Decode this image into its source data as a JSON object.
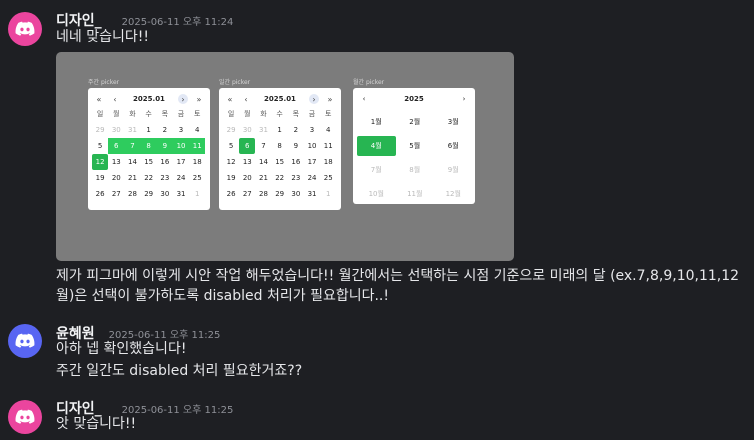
{
  "colors": {
    "background": "#1e1f23",
    "avatar_pink": "#eb459e",
    "avatar_blue": "#5865f2",
    "selected_green": "#2ecc5e"
  },
  "messages": [
    {
      "author": "디자인_",
      "timestamp": "2025-06-11 오후 11:24",
      "avatar_icon": "discord-icon",
      "lines": [
        "네네 맞습니다!!"
      ]
    },
    {
      "caption": "제가 피그마에 이렇게 시안 작업 해두었습니다!! 월간에서는 선택하는 시점 기준으로 미래의 달 (ex.7,8,9,10,11,12월)은 선택이 불가하도록 disabled 처리가 필요합니다..!"
    },
    {
      "author": "윤혜원",
      "timestamp": "2025-06-11 오후 11:25",
      "avatar_icon": "discord-icon",
      "lines": [
        "아하 넵 확인했습니다!",
        "주간 일간도 disabled 처리 필요한거죠??"
      ]
    },
    {
      "author": "디자인_",
      "timestamp": "2025-06-11 오후 11:25",
      "avatar_icon": "discord-icon",
      "lines": [
        "앗 맞습니다!!"
      ]
    }
  ],
  "pickers": {
    "weekly": {
      "label": "주간 picker",
      "title": "2025.01",
      "nav": {
        "first": "«",
        "prev": "‹",
        "next": "›",
        "last": "»"
      },
      "dow": [
        "일",
        "월",
        "화",
        "수",
        "목",
        "금",
        "토"
      ],
      "days": [
        "29",
        "30",
        "31",
        "1",
        "2",
        "3",
        "4",
        "5",
        "6",
        "7",
        "8",
        "9",
        "10",
        "11",
        "12",
        "13",
        "14",
        "15",
        "16",
        "17",
        "18",
        "19",
        "20",
        "21",
        "22",
        "23",
        "24",
        "25",
        "26",
        "27",
        "28",
        "29",
        "30",
        "31",
        "1"
      ]
    },
    "daily": {
      "label": "일간 picker",
      "title": "2025.01",
      "nav": {
        "first": "«",
        "prev": "‹",
        "next": "›",
        "last": "»"
      },
      "dow": [
        "일",
        "월",
        "화",
        "수",
        "목",
        "금",
        "토"
      ],
      "days": [
        "29",
        "30",
        "31",
        "1",
        "2",
        "3",
        "4",
        "5",
        "6",
        "7",
        "8",
        "9",
        "10",
        "11",
        "12",
        "13",
        "14",
        "15",
        "16",
        "17",
        "18",
        "19",
        "20",
        "21",
        "22",
        "23",
        "24",
        "25",
        "26",
        "27",
        "28",
        "29",
        "30",
        "31",
        "1"
      ]
    },
    "monthly": {
      "label": "월간 picker",
      "title": "2025",
      "nav": {
        "prev": "‹",
        "next": "›"
      },
      "months": [
        "1월",
        "2월",
        "3월",
        "4월",
        "5월",
        "6월",
        "7월",
        "8월",
        "9월",
        "10월",
        "11월",
        "12월"
      ]
    }
  }
}
